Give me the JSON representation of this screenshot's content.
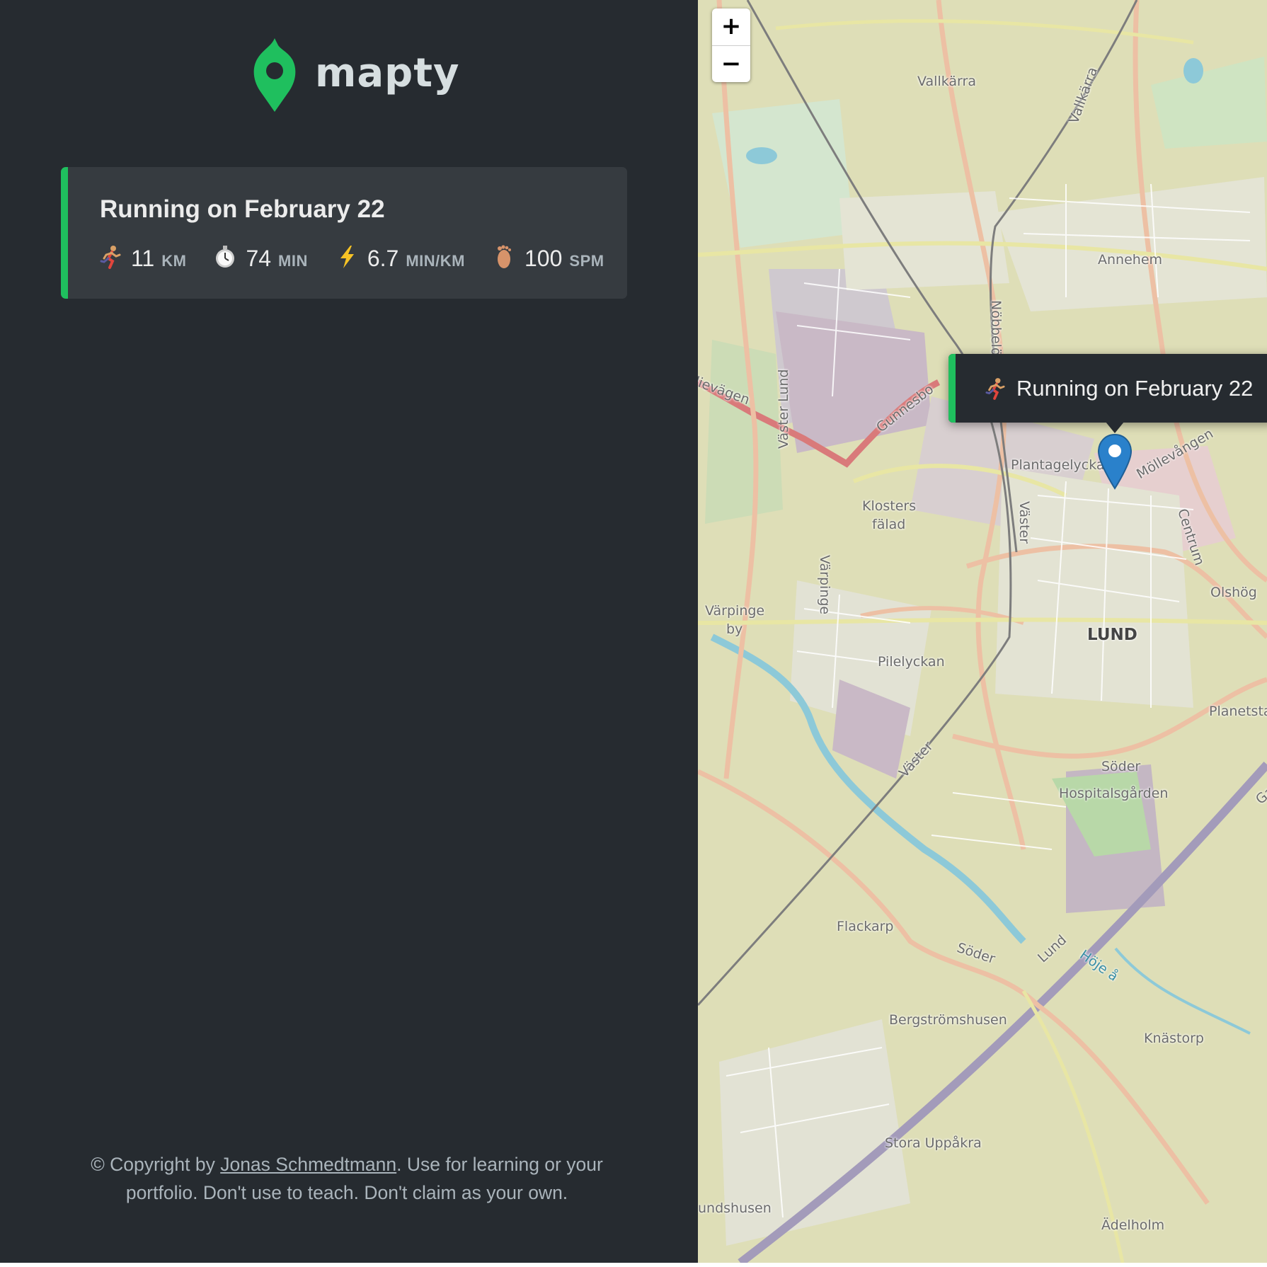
{
  "app": {
    "logo_text": "mapty",
    "logo_icon": "map-pin-icon"
  },
  "workouts": [
    {
      "title": "Running on February 22",
      "type": "running",
      "accent_color": "#1fbf5e",
      "details": [
        {
          "icon": "runner-icon",
          "value": "11",
          "unit": "KM"
        },
        {
          "icon": "stopwatch-icon",
          "value": "74",
          "unit": "MIN"
        },
        {
          "icon": "lightning-icon",
          "value": "6.7",
          "unit": "MIN/KM"
        },
        {
          "icon": "footprint-icon",
          "value": "100",
          "unit": "SPM"
        }
      ]
    }
  ],
  "footer": {
    "prefix": "© Copyright by ",
    "link_text": "Jonas Schmedtmann",
    "suffix": ". Use for learning or your portfolio. Don't use to teach. Don't claim as your own."
  },
  "map": {
    "zoom_in": "+",
    "zoom_out": "−",
    "popup": {
      "text": "Running on February 22",
      "icon": "runner-icon",
      "close": "×"
    },
    "place_labels": [
      "Vallkärra",
      "Annehem",
      "Nöbbelöv",
      "Vallkärra",
      "Gunnesbo",
      "Väster Lund",
      "lievägen",
      "Plantagelyckan",
      "Möllevången",
      "Klosters",
      "fälad",
      "Väster",
      "Centrum",
      "Värpinge",
      "Värpinge",
      "by",
      "Olshög",
      "LUND",
      "Pilelyckan",
      "Planetstaden",
      "Väster",
      "Söder",
      "Hospitalsgården",
      "Ga",
      "Flackarp",
      "Söder",
      "Lund",
      "Höje å",
      "Bergströmshusen",
      "Knästorp",
      "Stora Uppåkra",
      "undshusen",
      "Ädelholm"
    ]
  },
  "colors": {
    "sidebar_bg": "#262b30",
    "card_bg": "#363b40",
    "accent_running": "#1fbf5e",
    "map_base": "#dcdcb1",
    "marker": "#2a81cb"
  }
}
